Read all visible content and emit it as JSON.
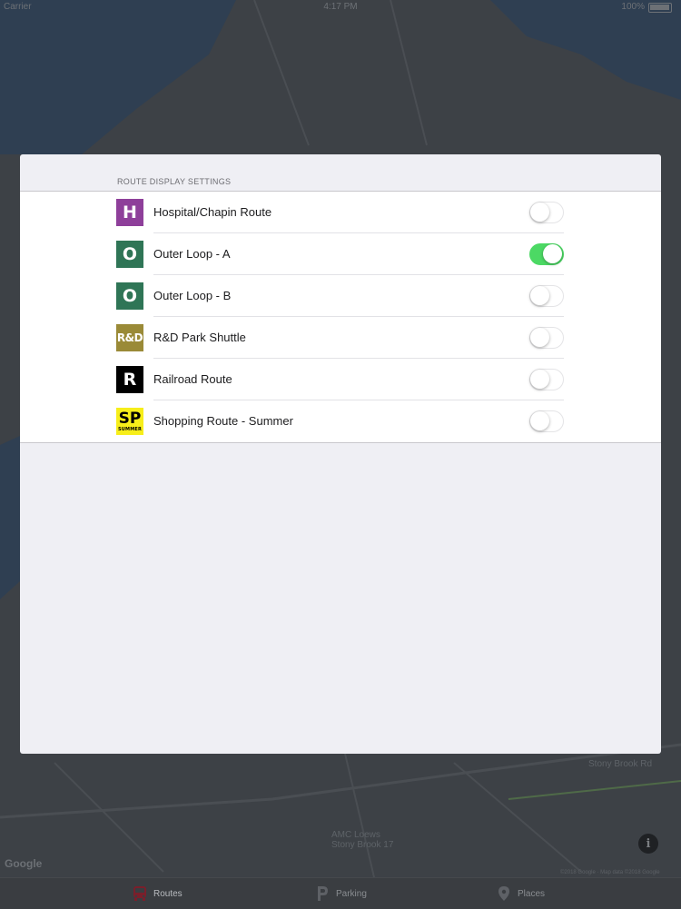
{
  "status_bar": {
    "carrier": "Carrier",
    "time": "4:17 PM",
    "battery": "100%"
  },
  "map": {
    "labels": {
      "road_label": "Stony Brook Rd",
      "place_label": "AMC Loews Stony Brook 17",
      "attribution": "©2018 Google · Map data ©2018 Google",
      "google": "Google"
    }
  },
  "settings_sheet": {
    "section_header": "ROUTE DISPLAY SETTINGS",
    "routes": [
      {
        "badge": "H",
        "badge_color": "#8e3f9a",
        "label": "Hospital/Chapin Route",
        "enabled": false
      },
      {
        "badge": "O",
        "badge_color": "#2f7556",
        "label": "Outer Loop - A",
        "enabled": true
      },
      {
        "badge": "O",
        "badge_color": "#2f7556",
        "label": "Outer Loop - B",
        "enabled": false
      },
      {
        "badge": "R&D",
        "badge_color": "#9a8a37",
        "label": "R&D Park Shuttle",
        "enabled": false
      },
      {
        "badge": "R",
        "badge_color": "#000000",
        "label": "Railroad Route",
        "enabled": false
      },
      {
        "badge": "SP",
        "badge_sub": "SUMMER",
        "badge_color": "#f7ee1a",
        "label": "Shopping Route - Summer",
        "enabled": false
      }
    ]
  },
  "tab_bar": {
    "tabs": [
      {
        "label": "Routes",
        "icon": "bus-icon",
        "active": true
      },
      {
        "label": "Parking",
        "icon": "parking-icon",
        "active": false
      },
      {
        "label": "Places",
        "icon": "map-pin-icon",
        "active": false
      }
    ]
  },
  "colors": {
    "toggle_on": "#4cd964",
    "sheet_background": "#efeff4"
  }
}
